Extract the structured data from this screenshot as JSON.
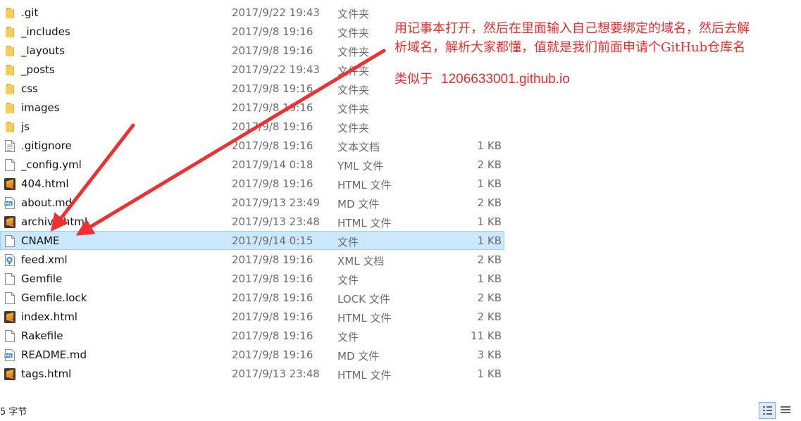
{
  "files": [
    {
      "name": ".git",
      "date": "2017/9/22 19:43",
      "type": "文件夹",
      "size": "",
      "icon": "folder-icon"
    },
    {
      "name": "_includes",
      "date": "2017/9/8 19:16",
      "type": "文件夹",
      "size": "",
      "icon": "folder-icon"
    },
    {
      "name": "_layouts",
      "date": "2017/9/8 19:16",
      "type": "文件夹",
      "size": "",
      "icon": "folder-icon"
    },
    {
      "name": "_posts",
      "date": "2017/9/22 19:43",
      "type": "文件夹",
      "size": "",
      "icon": "folder-icon"
    },
    {
      "name": "css",
      "date": "2017/9/8 19:16",
      "type": "文件夹",
      "size": "",
      "icon": "folder-icon"
    },
    {
      "name": "images",
      "date": "2017/9/8 19:16",
      "type": "文件夹",
      "size": "",
      "icon": "folder-icon"
    },
    {
      "name": "js",
      "date": "2017/9/8 19:16",
      "type": "文件夹",
      "size": "",
      "icon": "folder-icon"
    },
    {
      "name": ".gitignore",
      "date": "2017/9/8 19:16",
      "type": "文本文档",
      "size": "1 KB",
      "icon": "text-document-icon"
    },
    {
      "name": "_config.yml",
      "date": "2017/9/14 0:18",
      "type": "YML 文件",
      "size": "2 KB",
      "icon": "blank-file-icon"
    },
    {
      "name": "404.html",
      "date": "2017/9/8 19:16",
      "type": "HTML 文件",
      "size": "1 KB",
      "icon": "sublime-text-icon"
    },
    {
      "name": "about.md",
      "date": "2017/9/13 23:49",
      "type": "MD 文件",
      "size": "2 KB",
      "icon": "markdown-file-icon"
    },
    {
      "name": "archive.html",
      "date": "2017/9/13 23:48",
      "type": "HTML 文件",
      "size": "1 KB",
      "icon": "sublime-text-icon"
    },
    {
      "name": "CNAME",
      "date": "2017/9/14 0:15",
      "type": "文件",
      "size": "1 KB",
      "icon": "blank-file-icon",
      "selected": true
    },
    {
      "name": "feed.xml",
      "date": "2017/9/8 19:16",
      "type": "XML 文档",
      "size": "2 KB",
      "icon": "xml-document-icon"
    },
    {
      "name": "Gemfile",
      "date": "2017/9/8 19:16",
      "type": "文件",
      "size": "1 KB",
      "icon": "blank-file-icon"
    },
    {
      "name": "Gemfile.lock",
      "date": "2017/9/8 19:16",
      "type": "LOCK 文件",
      "size": "2 KB",
      "icon": "blank-file-icon"
    },
    {
      "name": "index.html",
      "date": "2017/9/8 19:16",
      "type": "HTML 文件",
      "size": "2 KB",
      "icon": "sublime-text-icon"
    },
    {
      "name": "Rakefile",
      "date": "2017/9/8 19:16",
      "type": "文件",
      "size": "11 KB",
      "icon": "blank-file-icon"
    },
    {
      "name": "README.md",
      "date": "2017/9/8 19:16",
      "type": "MD 文件",
      "size": "3 KB",
      "icon": "markdown-file-icon"
    },
    {
      "name": "tags.html",
      "date": "2017/9/13 23:48",
      "type": "HTML 文件",
      "size": "1 KB",
      "icon": "sublime-text-icon"
    }
  ],
  "annotation": {
    "line1": "用记事本打开，然后在里面输入自己想要绑定的域名，然后去解",
    "line2": "析域名，解析大家都懂，值就是我们前面申请个GitHub仓库名",
    "example_label": "类似于",
    "example_value": "1206633001.github.io",
    "color": "#ee2b2b"
  },
  "statusbar": {
    "text": "5 字节",
    "details_view_icon": "details-view-icon",
    "large_icons_view_icon": "large-icons-view-icon"
  },
  "colors": {
    "selection_bg": "#cce8ff",
    "selection_border": "#99d1ff",
    "folder": "#f5c74a",
    "sublime": "#f28c1e"
  }
}
